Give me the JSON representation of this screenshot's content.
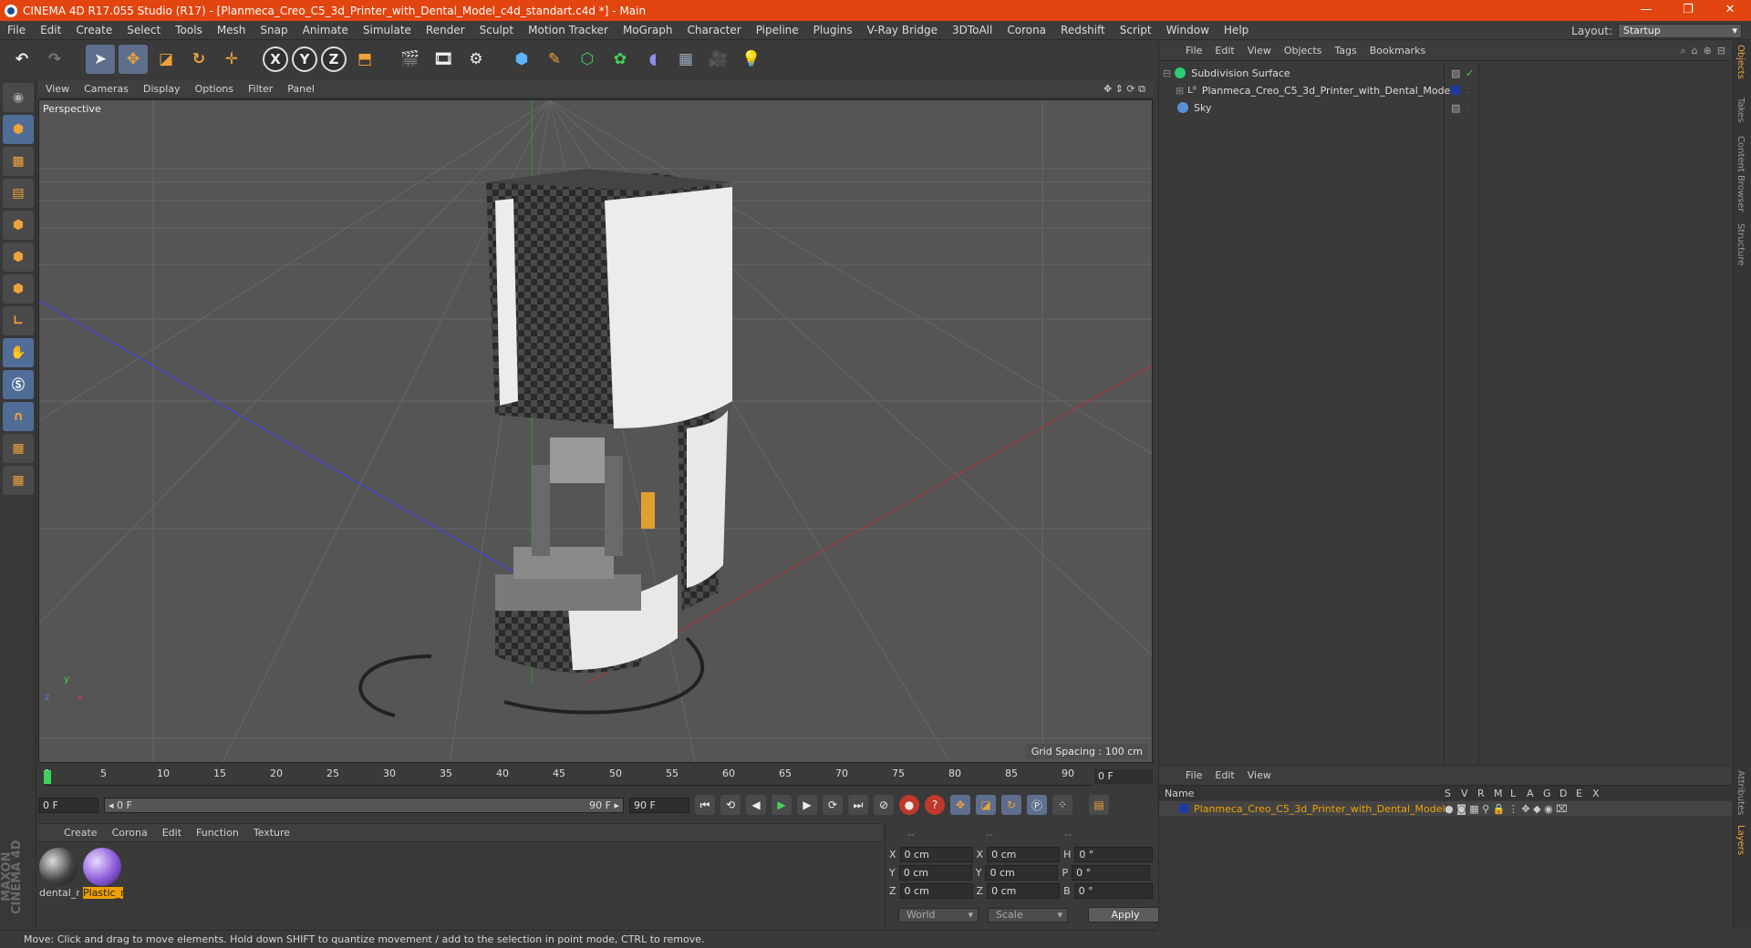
{
  "window": {
    "title": "CINEMA 4D R17.055 Studio (R17) - [Planmeca_Creo_C5_3d_Printer_with_Dental_Model_c4d_standart.c4d *] - Main",
    "minimize": "—",
    "maximize": "❐",
    "close": "✕"
  },
  "menubar": {
    "items": [
      "File",
      "Edit",
      "Create",
      "Select",
      "Tools",
      "Mesh",
      "Snap",
      "Animate",
      "Simulate",
      "Render",
      "Sculpt",
      "Motion Tracker",
      "MoGraph",
      "Character",
      "Pipeline",
      "Plugins",
      "V-Ray Bridge",
      "3DToAll",
      "Corona",
      "Redshift",
      "Script",
      "Window",
      "Help"
    ],
    "layout_label": "Layout:",
    "layout_value": "Startup"
  },
  "toolbar": {
    "axis_x": "X",
    "axis_y": "Y",
    "axis_z": "Z"
  },
  "viewport": {
    "menu": [
      "View",
      "Cameras",
      "Display",
      "Options",
      "Filter",
      "Panel"
    ],
    "label": "Perspective",
    "grid_spacing": "Grid Spacing : 100 cm",
    "axis_y": "y",
    "axis_x": "x",
    "axis_z": "z"
  },
  "timeline": {
    "ticks": [
      "0",
      "5",
      "10",
      "15",
      "20",
      "25",
      "30",
      "35",
      "40",
      "45",
      "50",
      "55",
      "60",
      "65",
      "70",
      "75",
      "80",
      "85",
      "90"
    ],
    "frame_end_box": "0 F",
    "current_frame": "0 F",
    "range_start": "◂ 0 F",
    "range_end": "90 F ▸",
    "max_frame": "90 F"
  },
  "materials": {
    "menu": [
      "Create",
      "Corona",
      "Edit",
      "Function",
      "Texture"
    ],
    "items": [
      {
        "label": "dental_r",
        "selected": false
      },
      {
        "label": "Plastic_r",
        "selected": true
      }
    ]
  },
  "coords": {
    "header": [
      "--",
      "--",
      "--"
    ],
    "rows": [
      {
        "a": "X",
        "v1": "0 cm",
        "b": "X",
        "v2": "0 cm",
        "c": "H",
        "v3": "0 °"
      },
      {
        "a": "Y",
        "v1": "0 cm",
        "b": "Y",
        "v2": "0 cm",
        "c": "P",
        "v3": "0 °"
      },
      {
        "a": "Z",
        "v1": "0 cm",
        "b": "Z",
        "v2": "0 cm",
        "c": "B",
        "v3": "0 °"
      }
    ],
    "mode1": "World",
    "mode2": "Scale",
    "apply": "Apply"
  },
  "status": "Move: Click and drag to move elements. Hold down SHIFT to quantize movement / add to the selection in point mode, CTRL to remove.",
  "brand": "MAXON CINEMA 4D",
  "object_manager": {
    "menu": [
      "File",
      "Edit",
      "View",
      "Objects",
      "Tags",
      "Bookmarks"
    ],
    "objects": [
      {
        "name": "Subdivision Surface",
        "color": "#2ecc71"
      },
      {
        "name": "Planmeca_Creo_C5_3d_Printer_with_Dental_Model",
        "color": "#3a6fd8"
      },
      {
        "name": "Sky",
        "color": "#5b8fd9"
      }
    ]
  },
  "layer_manager": {
    "menu": [
      "File",
      "Edit",
      "View"
    ],
    "columns": [
      "Name",
      "S",
      "V",
      "R",
      "M",
      "L",
      "A",
      "G",
      "D",
      "E",
      "X"
    ],
    "layer_name": "Planmeca_Creo_C5_3d_Printer_with_Dental_Model"
  },
  "right_tabs": [
    "Objects",
    "Takes",
    "Content Browser",
    "Structure",
    "Attributes",
    "Layers"
  ]
}
